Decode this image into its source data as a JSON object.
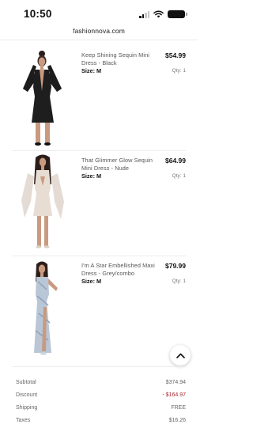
{
  "status_bar": {
    "time": "10:50",
    "icons": [
      "cellular-signal-icon",
      "wifi-icon",
      "battery-icon"
    ]
  },
  "browser": {
    "url": "fashionnova.com"
  },
  "products": [
    {
      "name": "Keep Shining Sequin Mini Dress - Black",
      "size": "Size: M",
      "price": "$54.99",
      "qty": "Qty: 1"
    },
    {
      "name": "That Glimmer Glow Sequin Mini Dress - Nude",
      "size": "Size: M",
      "price": "$64.99",
      "qty": "Qty: 1"
    },
    {
      "name": "I'm A Star Embellished Maxi Dress - Grey/combo",
      "size": "Size: M",
      "price": "$79.99",
      "qty": "Qty: 1"
    }
  ],
  "scroll_to_top": {
    "icon": "chevron-up-icon"
  },
  "summary": [
    {
      "label": "Subtotal",
      "value": "$374.94"
    },
    {
      "label": "Discount",
      "value": "- $164.97"
    },
    {
      "label": "Shipping",
      "value": "FREE"
    },
    {
      "label": "Taxes",
      "value": "$16.26"
    }
  ],
  "colors": {
    "discount": "#a3282f",
    "text": "#111111",
    "muted": "#666666"
  }
}
